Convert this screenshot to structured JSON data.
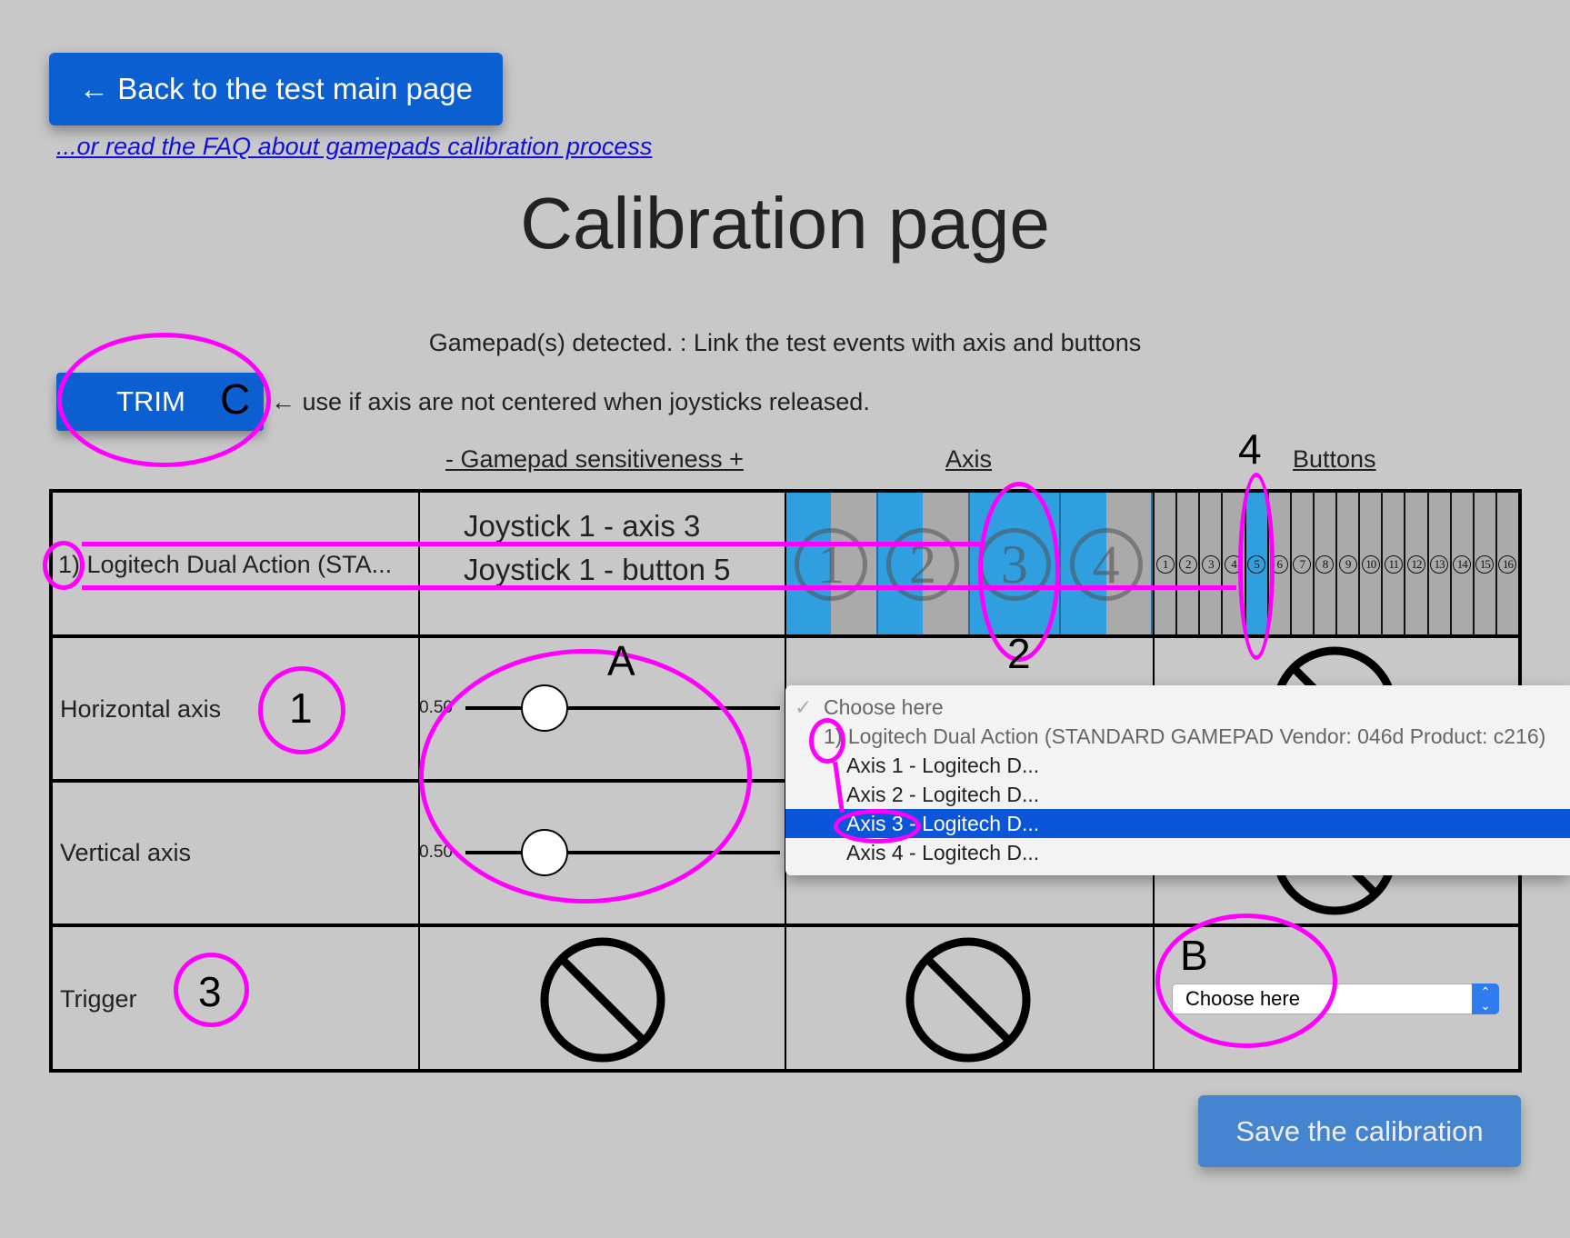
{
  "nav": {
    "back_button": "← Back to the test main page",
    "faq_link": "...or read the FAQ about gamepads calibration process"
  },
  "page": {
    "title": "Calibration page",
    "status": "Gamepad(s) detected. : Link the test events with axis and buttons"
  },
  "trim": {
    "button_label": "TRIM",
    "hint": "← use if axis are not centered when joysticks released."
  },
  "headers": {
    "sensitiveness": "- Gamepad sensitiveness +",
    "axis": "Axis",
    "buttons": "Buttons"
  },
  "gamepad_row": {
    "name": "1) Logitech Dual Action (STA...",
    "event_axis": "Joystick 1 - axis 3",
    "event_button": "Joystick 1 - button 5",
    "axes": [
      {
        "label": "1",
        "fill": 0.5
      },
      {
        "label": "2",
        "fill": 0.5
      },
      {
        "label": "3",
        "fill": 1.0
      },
      {
        "label": "4",
        "fill": 0.5
      }
    ],
    "buttons": [
      {
        "label": "1",
        "pressed": false
      },
      {
        "label": "2",
        "pressed": false
      },
      {
        "label": "3",
        "pressed": false
      },
      {
        "label": "4",
        "pressed": false
      },
      {
        "label": "5",
        "pressed": true
      },
      {
        "label": "6",
        "pressed": false
      },
      {
        "label": "7",
        "pressed": false
      },
      {
        "label": "8",
        "pressed": false
      },
      {
        "label": "9",
        "pressed": false
      },
      {
        "label": "10",
        "pressed": false
      },
      {
        "label": "11",
        "pressed": false
      },
      {
        "label": "12",
        "pressed": false
      },
      {
        "label": "13",
        "pressed": false
      },
      {
        "label": "14",
        "pressed": false
      },
      {
        "label": "15",
        "pressed": false
      },
      {
        "label": "16",
        "pressed": false
      }
    ]
  },
  "rows": {
    "horizontal": {
      "label": "Horizontal axis",
      "sensitivity_value": "0.50",
      "slider_fraction": 0.25
    },
    "vertical": {
      "label": "Vertical axis",
      "sensitivity_value": "0.50",
      "slider_fraction": 0.25
    },
    "trigger": {
      "label": "Trigger",
      "select_value": "Choose here"
    }
  },
  "dropdown": {
    "items": [
      {
        "label": "Choose here",
        "type": "checked",
        "check": "✓"
      },
      {
        "label": "1) Logitech Dual Action (STANDARD GAMEPAD Vendor: 046d Product: c216)",
        "type": "header"
      },
      {
        "label": "Axis 1 - Logitech D...",
        "type": "option"
      },
      {
        "label": "Axis 2 - Logitech D...",
        "type": "option"
      },
      {
        "label": "Axis 3 - Logitech D...",
        "type": "selected"
      },
      {
        "label": "Axis 4 - Logitech D...",
        "type": "option"
      }
    ]
  },
  "save_button": "Save the calibration",
  "annotations": {
    "A": "A",
    "B": "B",
    "C": "C",
    "n1": "1",
    "n2": "2",
    "n3": "3",
    "n4": "4"
  },
  "icons": {
    "disabled": "prohibited-icon",
    "select_arrows": "⌃⌄"
  },
  "colors": {
    "accent": "#0b5fd1",
    "axis_active": "#2f9fe0",
    "inactive": "#aaaaaa",
    "annotation": "#ff00ff",
    "background": "#c8c8c8"
  }
}
